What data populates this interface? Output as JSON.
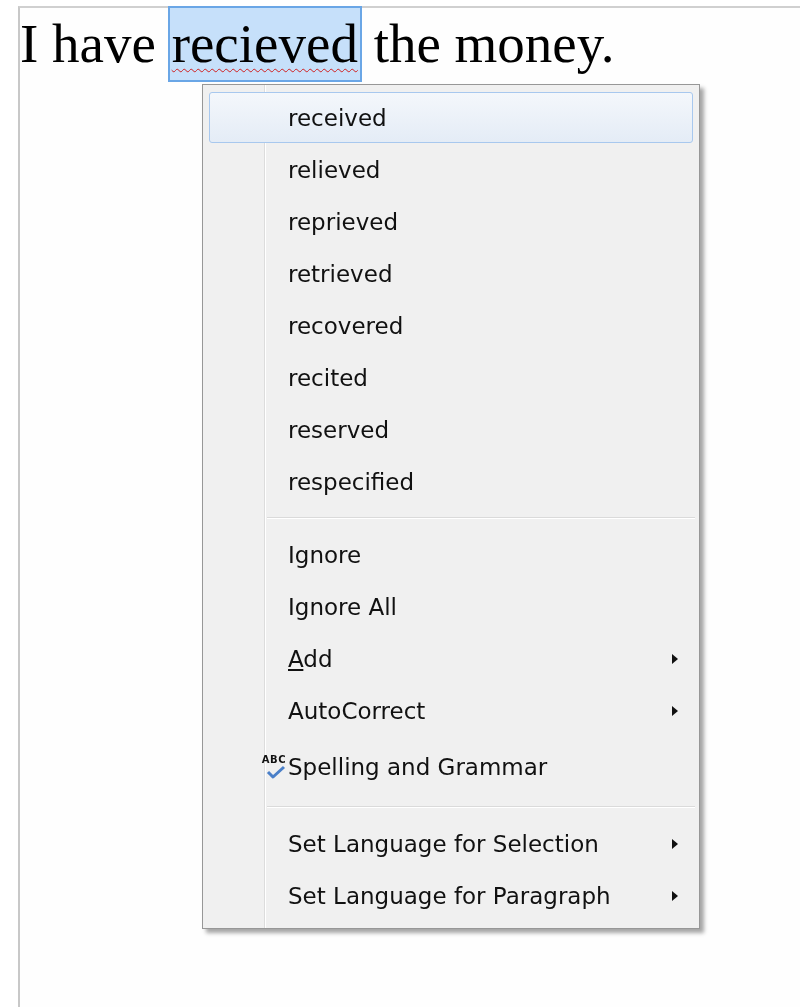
{
  "document": {
    "before": "I have",
    "misspelled": "recieved",
    "after": "the money.",
    "selected": true
  },
  "context_menu": {
    "items": [
      {
        "kind": "item",
        "label": "received",
        "selected": true,
        "submenu": false
      },
      {
        "kind": "item",
        "label": "relieved",
        "selected": false,
        "submenu": false
      },
      {
        "kind": "item",
        "label": "reprieved",
        "selected": false,
        "submenu": false
      },
      {
        "kind": "item",
        "label": "retrieved",
        "selected": false,
        "submenu": false
      },
      {
        "kind": "item",
        "label": "recovered",
        "selected": false,
        "submenu": false
      },
      {
        "kind": "item",
        "label": "recited",
        "selected": false,
        "submenu": false
      },
      {
        "kind": "item",
        "label": "reserved",
        "selected": false,
        "submenu": false
      },
      {
        "kind": "item",
        "label": "respecified",
        "selected": false,
        "submenu": false
      },
      {
        "kind": "separator"
      },
      {
        "kind": "item",
        "label": "Ignore",
        "selected": false,
        "submenu": false
      },
      {
        "kind": "item",
        "label": "Ignore All",
        "selected": false,
        "submenu": false
      },
      {
        "kind": "item",
        "label": "Add",
        "first_letter_underlined": true,
        "selected": false,
        "submenu": true
      },
      {
        "kind": "item",
        "label": "AutoCorrect",
        "selected": false,
        "submenu": true
      },
      {
        "kind": "icon_item",
        "label": "Spelling and Grammar",
        "icon_text": "ABC",
        "selected": false,
        "submenu": false
      },
      {
        "kind": "separator"
      },
      {
        "kind": "item",
        "label": "Set Language for Selection",
        "selected": false,
        "submenu": true
      },
      {
        "kind": "item",
        "label": "Set Language for Paragraph",
        "selected": false,
        "submenu": true
      }
    ]
  }
}
